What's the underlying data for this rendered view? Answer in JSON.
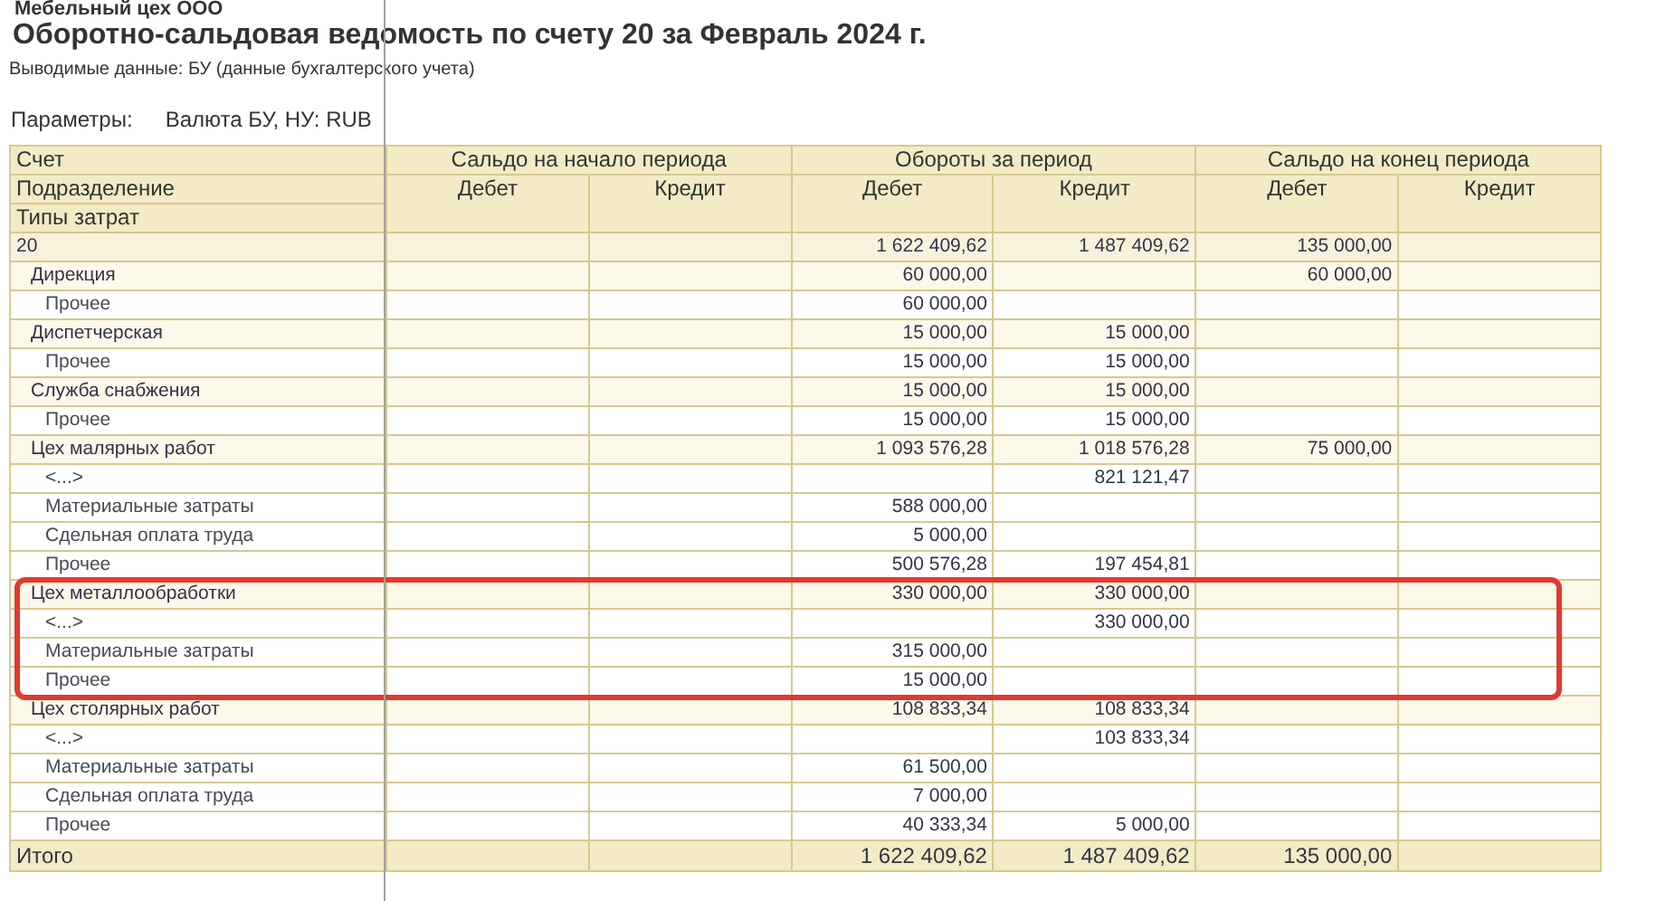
{
  "report": {
    "organization": "Мебельный цех ООО",
    "title": "Оборотно-сальдовая ведомость по счету 20 за Февраль 2024 г.",
    "output_data": "Выводимые данные: БУ (данные бухгалтерского учета)",
    "parameters_label": "Параметры:",
    "parameters_value": "Валюта БУ, НУ: RUB"
  },
  "table": {
    "row_labels": [
      "Счет",
      "Подразделение",
      "Типы затрат"
    ],
    "groups": [
      {
        "title": "Сальдо на начало периода",
        "columns": [
          "Дебет",
          "Кредит"
        ]
      },
      {
        "title": "Обороты за период",
        "columns": [
          "Дебет",
          "Кредит"
        ]
      },
      {
        "title": "Сальдо на конец периода",
        "columns": [
          "Дебет",
          "Кредит"
        ]
      }
    ],
    "rows": [
      {
        "name": "20",
        "highlighted": false,
        "turnover_debit": "1 622 409,62",
        "turnover_credit": "1 487 409,62",
        "closing_debit": "135 000,00",
        "children": [
          {
            "name": "Дирекция",
            "highlighted": false,
            "turnover_debit": "60 000,00",
            "closing_debit": "60 000,00",
            "children": [
              {
                "name": "Прочее",
                "highlighted": false,
                "turnover_debit": "60 000,00"
              }
            ]
          },
          {
            "name": "Диспетчерская",
            "highlighted": false,
            "turnover_debit": "15 000,00",
            "turnover_credit": "15 000,00",
            "children": [
              {
                "name": "Прочее",
                "highlighted": false,
                "turnover_debit": "15 000,00",
                "turnover_credit": "15 000,00"
              }
            ]
          },
          {
            "name": "Служба снабжения",
            "highlighted": false,
            "turnover_debit": "15 000,00",
            "turnover_credit": "15 000,00",
            "children": [
              {
                "name": "Прочее",
                "highlighted": false,
                "turnover_debit": "15 000,00",
                "turnover_credit": "15 000,00"
              }
            ]
          },
          {
            "name": "Цех малярных работ",
            "highlighted": false,
            "turnover_debit": "1 093 576,28",
            "turnover_credit": "1 018 576,28",
            "closing_debit": "75 000,00",
            "children": [
              {
                "name": "<...>",
                "highlighted": false,
                "turnover_credit": "821 121,47"
              },
              {
                "name": "Материальные затраты",
                "highlighted": false,
                "turnover_debit": "588 000,00"
              },
              {
                "name": "Сдельная оплата труда",
                "highlighted": false,
                "turnover_debit": "5 000,00"
              },
              {
                "name": "Прочее",
                "highlighted": false,
                "turnover_debit": "500 576,28",
                "turnover_credit": "197 454,81"
              }
            ]
          },
          {
            "name": "Цех металлообработки",
            "highlighted": true,
            "turnover_debit": "330 000,00",
            "turnover_credit": "330 000,00",
            "children": [
              {
                "name": "<...>",
                "highlighted": false,
                "turnover_credit": "330 000,00"
              },
              {
                "name": "Материальные затраты",
                "highlighted": false,
                "turnover_debit": "315 000,00"
              },
              {
                "name": "Прочее",
                "highlighted": false,
                "turnover_debit": "15 000,00"
              }
            ]
          },
          {
            "name": "Цех столярных работ",
            "highlighted": false,
            "turnover_debit": "108 833,34",
            "turnover_credit": "108 833,34",
            "children": [
              {
                "name": "<...>",
                "highlighted": false,
                "turnover_credit": "103 833,34"
              },
              {
                "name": "Материальные затраты",
                "highlighted": false,
                "turnover_debit": "61 500,00"
              },
              {
                "name": "Сдельная оплата труда",
                "highlighted": false,
                "turnover_debit": "7 000,00"
              },
              {
                "name": "Прочее",
                "highlighted": false,
                "turnover_debit": "40 333,34",
                "turnover_credit": "5 000,00"
              }
            ]
          }
        ]
      }
    ],
    "totals": {
      "label": "Итого",
      "turnover_debit": "1 622 409,62",
      "turnover_credit": "1 487 409,62",
      "closing_debit": "135 000,00"
    }
  }
}
